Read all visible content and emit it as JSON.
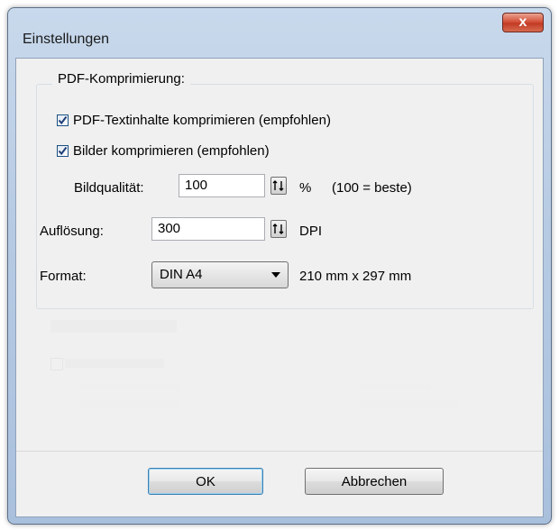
{
  "window": {
    "title": "Einstellungen",
    "close_glyph": "x"
  },
  "group": {
    "title": "PDF-Komprimierung:",
    "compress_text": {
      "label": "PDF-Textinhalte komprimieren (empfohlen)",
      "checked": true
    },
    "compress_images": {
      "label": "Bilder komprimieren (empfohlen)",
      "checked": true
    },
    "quality": {
      "label": "Bildqualität:",
      "value": "100",
      "unit": "%",
      "hint": "(100 = beste)"
    },
    "resolution": {
      "label": "Auflösung:",
      "value": "300",
      "unit": "DPI"
    },
    "format": {
      "label": "Format:",
      "selected": "DIN A4",
      "dimensions": "210 mm x 297 mm"
    }
  },
  "buttons": {
    "ok": "OK",
    "cancel": "Abbrechen"
  },
  "colors": {
    "accent": "#3c7fb1",
    "close": "#c23a24",
    "frame": "#b7cbe3"
  }
}
